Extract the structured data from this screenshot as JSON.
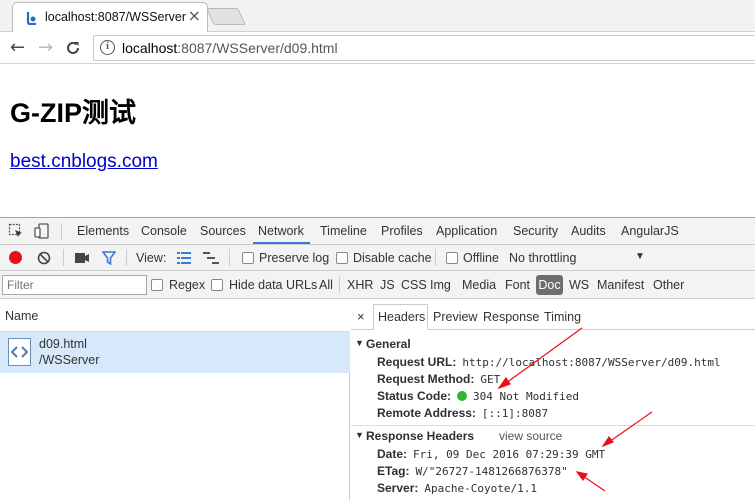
{
  "browser": {
    "tab_title": "localhost:8087/WSServer",
    "address_host": "localhost",
    "address_rest": ":8087/WSServer/d09.html"
  },
  "page": {
    "heading": "G-ZIP测试",
    "link": "best.cnblogs.com"
  },
  "devtools": {
    "tabs": [
      "Elements",
      "Console",
      "Sources",
      "Network",
      "Timeline",
      "Profiles",
      "Application",
      "Security",
      "Audits",
      "AngularJS"
    ],
    "selected_tab": "Network",
    "toolbar": {
      "view_label": "View:",
      "preserve_log": "Preserve log",
      "disable_cache": "Disable cache",
      "offline": "Offline",
      "throttling": "No throttling"
    },
    "filter": {
      "placeholder": "Filter",
      "regex": "Regex",
      "hide_data_urls": "Hide data URLs",
      "types": [
        "All",
        "XHR",
        "JS",
        "CSS",
        "Img",
        "Media",
        "Font",
        "Doc",
        "WS",
        "Manifest",
        "Other"
      ],
      "selected_type": "Doc"
    },
    "requests": {
      "name_header": "Name",
      "rows": [
        {
          "name": "d09.html",
          "path": "/WSServer"
        }
      ]
    },
    "detail": {
      "tabs": [
        "Headers",
        "Preview",
        "Response",
        "Timing"
      ],
      "selected_tab": "Headers",
      "general": {
        "title": "General",
        "request_url_k": "Request URL:",
        "request_url_v": "http://localhost:8087/WSServer/d09.html",
        "request_method_k": "Request Method:",
        "request_method_v": "GET",
        "status_code_k": "Status Code:",
        "status_code_v": "304 Not Modified",
        "remote_address_k": "Remote Address:",
        "remote_address_v": "[::1]:8087"
      },
      "response_headers": {
        "title": "Response Headers",
        "view_source": "view source",
        "date_k": "Date:",
        "date_v": "Fri, 09 Dec 2016 07:29:39 GMT",
        "etag_k": "ETag:",
        "etag_v": "W/\"26727-1481266876378\"",
        "server_k": "Server:",
        "server_v": "Apache-Coyote/1.1"
      }
    }
  },
  "colors": {
    "link": "#0000cc",
    "tab_underline": "#3879d9",
    "selected_row": "#d6e8fa",
    "status_dot": "#2fb52f",
    "record_dot": "#e8111a",
    "annotation_arrow": "#e8111a"
  }
}
